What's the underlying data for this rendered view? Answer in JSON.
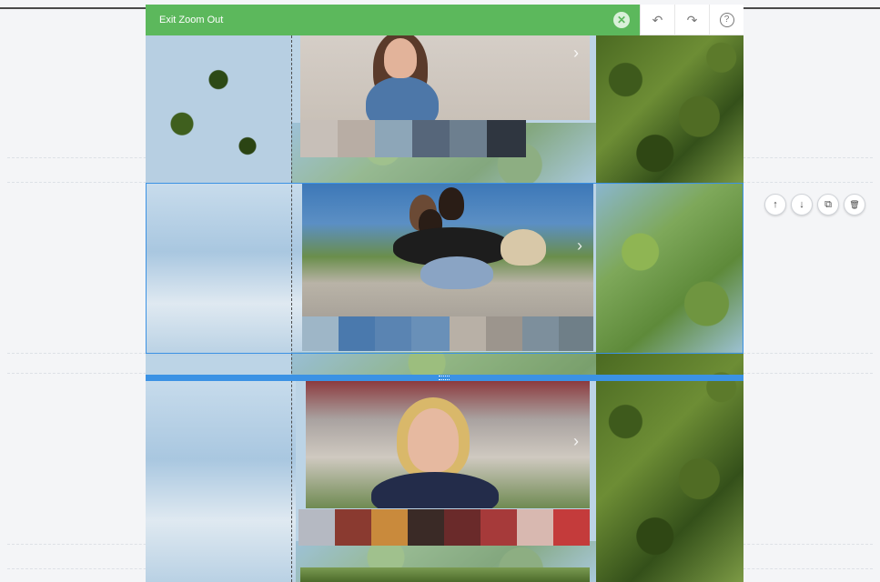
{
  "toolbar": {
    "exit_label": "Exit Zoom Out",
    "close_symbol": "✕",
    "undo_symbol": "↶",
    "redo_symbol": "↷",
    "help_symbol": "?"
  },
  "section_actions": {
    "move_up_symbol": "↑",
    "move_down_symbol": "↓",
    "duplicate_symbol": "⧉",
    "delete_symbol": "🗑"
  },
  "gallery": {
    "next_arrow_symbol": "›"
  },
  "colors": {
    "toolbar_green": "#5cb85c",
    "selection_blue": "#3b92e4"
  },
  "icons": [
    "close-icon",
    "undo-icon",
    "redo-icon",
    "help-icon",
    "arrow-up-icon",
    "arrow-down-icon",
    "duplicate-icon",
    "trash-icon",
    "chevron-right-icon",
    "drag-handle-icon"
  ]
}
